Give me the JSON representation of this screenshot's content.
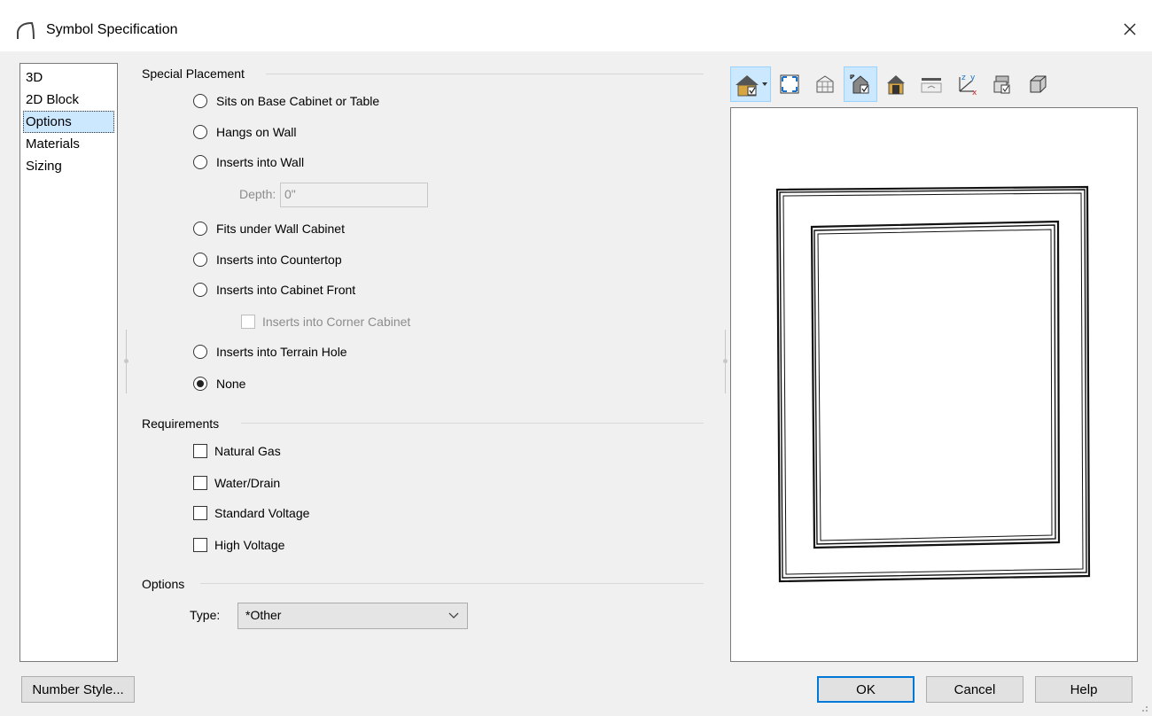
{
  "window": {
    "title": "Symbol Specification",
    "close_glyph": "✕"
  },
  "nav": {
    "items": [
      {
        "label": "3D"
      },
      {
        "label": "2D Block"
      },
      {
        "label": "Options",
        "selected": true
      },
      {
        "label": "Materials"
      },
      {
        "label": "Sizing"
      }
    ]
  },
  "special_placement": {
    "header": "Special Placement",
    "options": {
      "sits_on_base": "Sits on Base Cabinet or Table",
      "hangs_on_wall": "Hangs on Wall",
      "inserts_into_wall": "Inserts into Wall",
      "fits_under_wall_cabinet": "Fits under Wall Cabinet",
      "inserts_into_countertop": "Inserts into Countertop",
      "inserts_into_cabinet_front": "Inserts into Cabinet Front",
      "inserts_into_terrain_hole": "Inserts into Terrain Hole",
      "none": "None"
    },
    "selected": "none",
    "depth_label": "Depth:",
    "depth_value": "0\"",
    "corner_cabinet_label": "Inserts into Corner Cabinet"
  },
  "requirements": {
    "header": "Requirements",
    "natural_gas": "Natural Gas",
    "water_drain": "Water/Drain",
    "standard_voltage": "Standard Voltage",
    "high_voltage": "High Voltage"
  },
  "options": {
    "header": "Options",
    "type_label": "Type:",
    "type_value": "*Other"
  },
  "toolbar": {
    "icons": [
      "house-view-icon",
      "fill-window-icon",
      "glass-house-icon",
      "camera-view-icon",
      "backface-icon",
      "elevation-icon",
      "axes-icon",
      "layers-icon",
      "cube-icon"
    ]
  },
  "buttons": {
    "number_style": "Number Style...",
    "ok": "OK",
    "cancel": "Cancel",
    "help": "Help"
  },
  "colors": {
    "accent": "#0078d7",
    "selected_bg": "#cce8ff"
  }
}
